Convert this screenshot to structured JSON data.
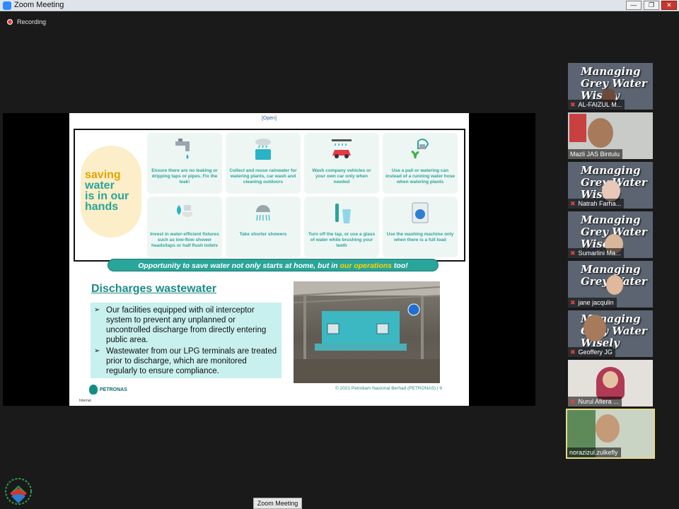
{
  "window": {
    "title": "Zoom Meeting",
    "minimize": "—",
    "restore": "❐",
    "close": "✕"
  },
  "recording_label": "Recording",
  "slide": {
    "classification": "[Open]",
    "saving_title": [
      "saving",
      "water",
      "is in our",
      "hands"
    ],
    "tips": [
      "Ensure there are no leaking or dripping taps or pipes. Fix the leak!",
      "Collect and reuse rainwater for watering plants, car wash and cleaning outdoors",
      "Wash company vehicles or your own car only when needed",
      "Use a pail or watering can instead of a running water hose when watering plants",
      "Invest in water-efficient fixtures such as low-flow shower heads/taps or half flush toilets",
      "Take shorter showers",
      "Turn off the tap, or use a glass of water while brushing your teeth",
      "Use the washing machine only when there is a full load"
    ],
    "banner_main": "Opportunity to save water not only starts at home, but in ",
    "banner_highlight": "our operations",
    "banner_end": " too!",
    "section_title": "Discharges wastewater",
    "bullets": [
      "Our facilities equipped with oil interceptor system to prevent any unplanned or uncontrolled  discharge from directly entering public area.",
      "Wastewater from our LPG terminals are treated prior to discharge, which are monitored regularly to ensure compliance."
    ],
    "logo_text": "PETRONAS",
    "internal_label": "Internal",
    "copyright": "© 2021 Petroliam Nasional Berhad (PETRONAS)     |     9"
  },
  "participants": [
    {
      "name": "AL-FAIZUL M...",
      "bg_text": "Managing Grey Water Wisely",
      "muted": true
    },
    {
      "name": "Mazli JAS Bintulu",
      "bg_text": "",
      "muted": false
    },
    {
      "name": "Natrah Farha...",
      "bg_text": "Managing Grey Water Wisely",
      "muted": true
    },
    {
      "name": "Sumarlini Ma...",
      "bg_text": "Managing Grey Water Wisely",
      "muted": true
    },
    {
      "name": "jane jacqulin",
      "bg_text": "Managing Grey Water",
      "muted": true
    },
    {
      "name": "Geoffery JG",
      "bg_text": "Managing Grey Water Wisely",
      "muted": true
    },
    {
      "name": "Nurul Afiera ...",
      "bg_text": "",
      "muted": true
    },
    {
      "name": "norazizul.zulkefly",
      "bg_text": "",
      "muted": false,
      "active": true
    }
  ],
  "bottom_label": "Zoom Meeting",
  "colors": {
    "accent": "#2aa59a",
    "highlight": "#ffd400",
    "active_border": "#e6d98a"
  }
}
